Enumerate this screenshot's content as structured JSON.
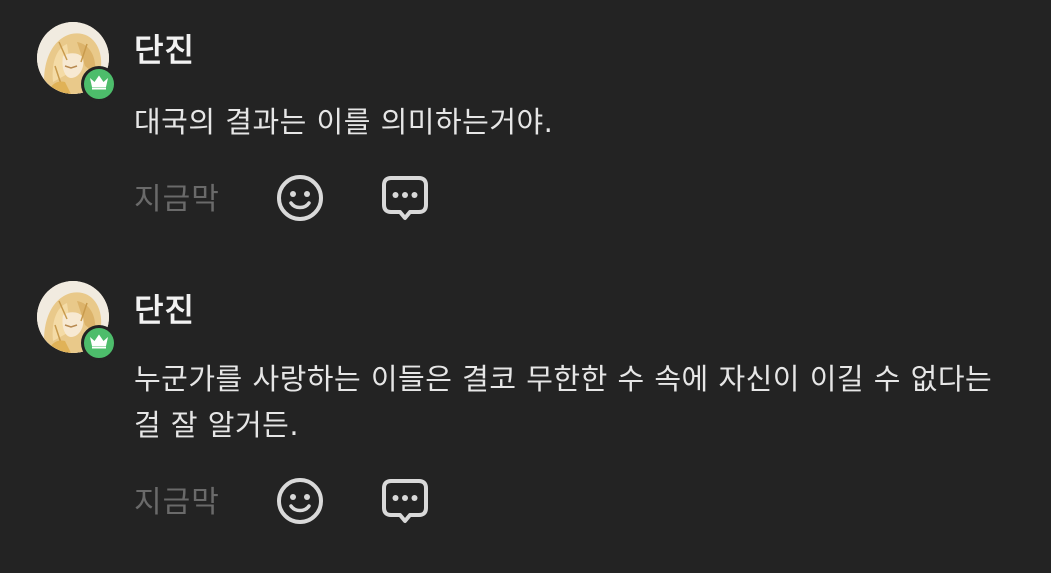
{
  "comments": [
    {
      "username": "단진",
      "text": "대국의 결과는 이를 의미하는거야.",
      "time": "지금막",
      "avatar_icon": "character-avatar",
      "badge_icon": "crown-icon",
      "actions": [
        "emoji-reaction-icon",
        "reply-bubble-icon"
      ]
    },
    {
      "username": "단진",
      "text": "누군가를 사랑하는 이들은 결코 무한한 수 속에 자신이 이길 수 없다는 걸 잘 알거든.",
      "time": "지금막",
      "avatar_icon": "character-avatar",
      "badge_icon": "crown-icon",
      "actions": [
        "emoji-reaction-icon",
        "reply-bubble-icon"
      ]
    }
  ],
  "colors": {
    "background": "#232323",
    "username": "#f2f2f2",
    "text": "#e6e6e6",
    "meta": "#6a6a6a",
    "badge": "#4dbd6b",
    "icon": "#d9d9d9"
  }
}
